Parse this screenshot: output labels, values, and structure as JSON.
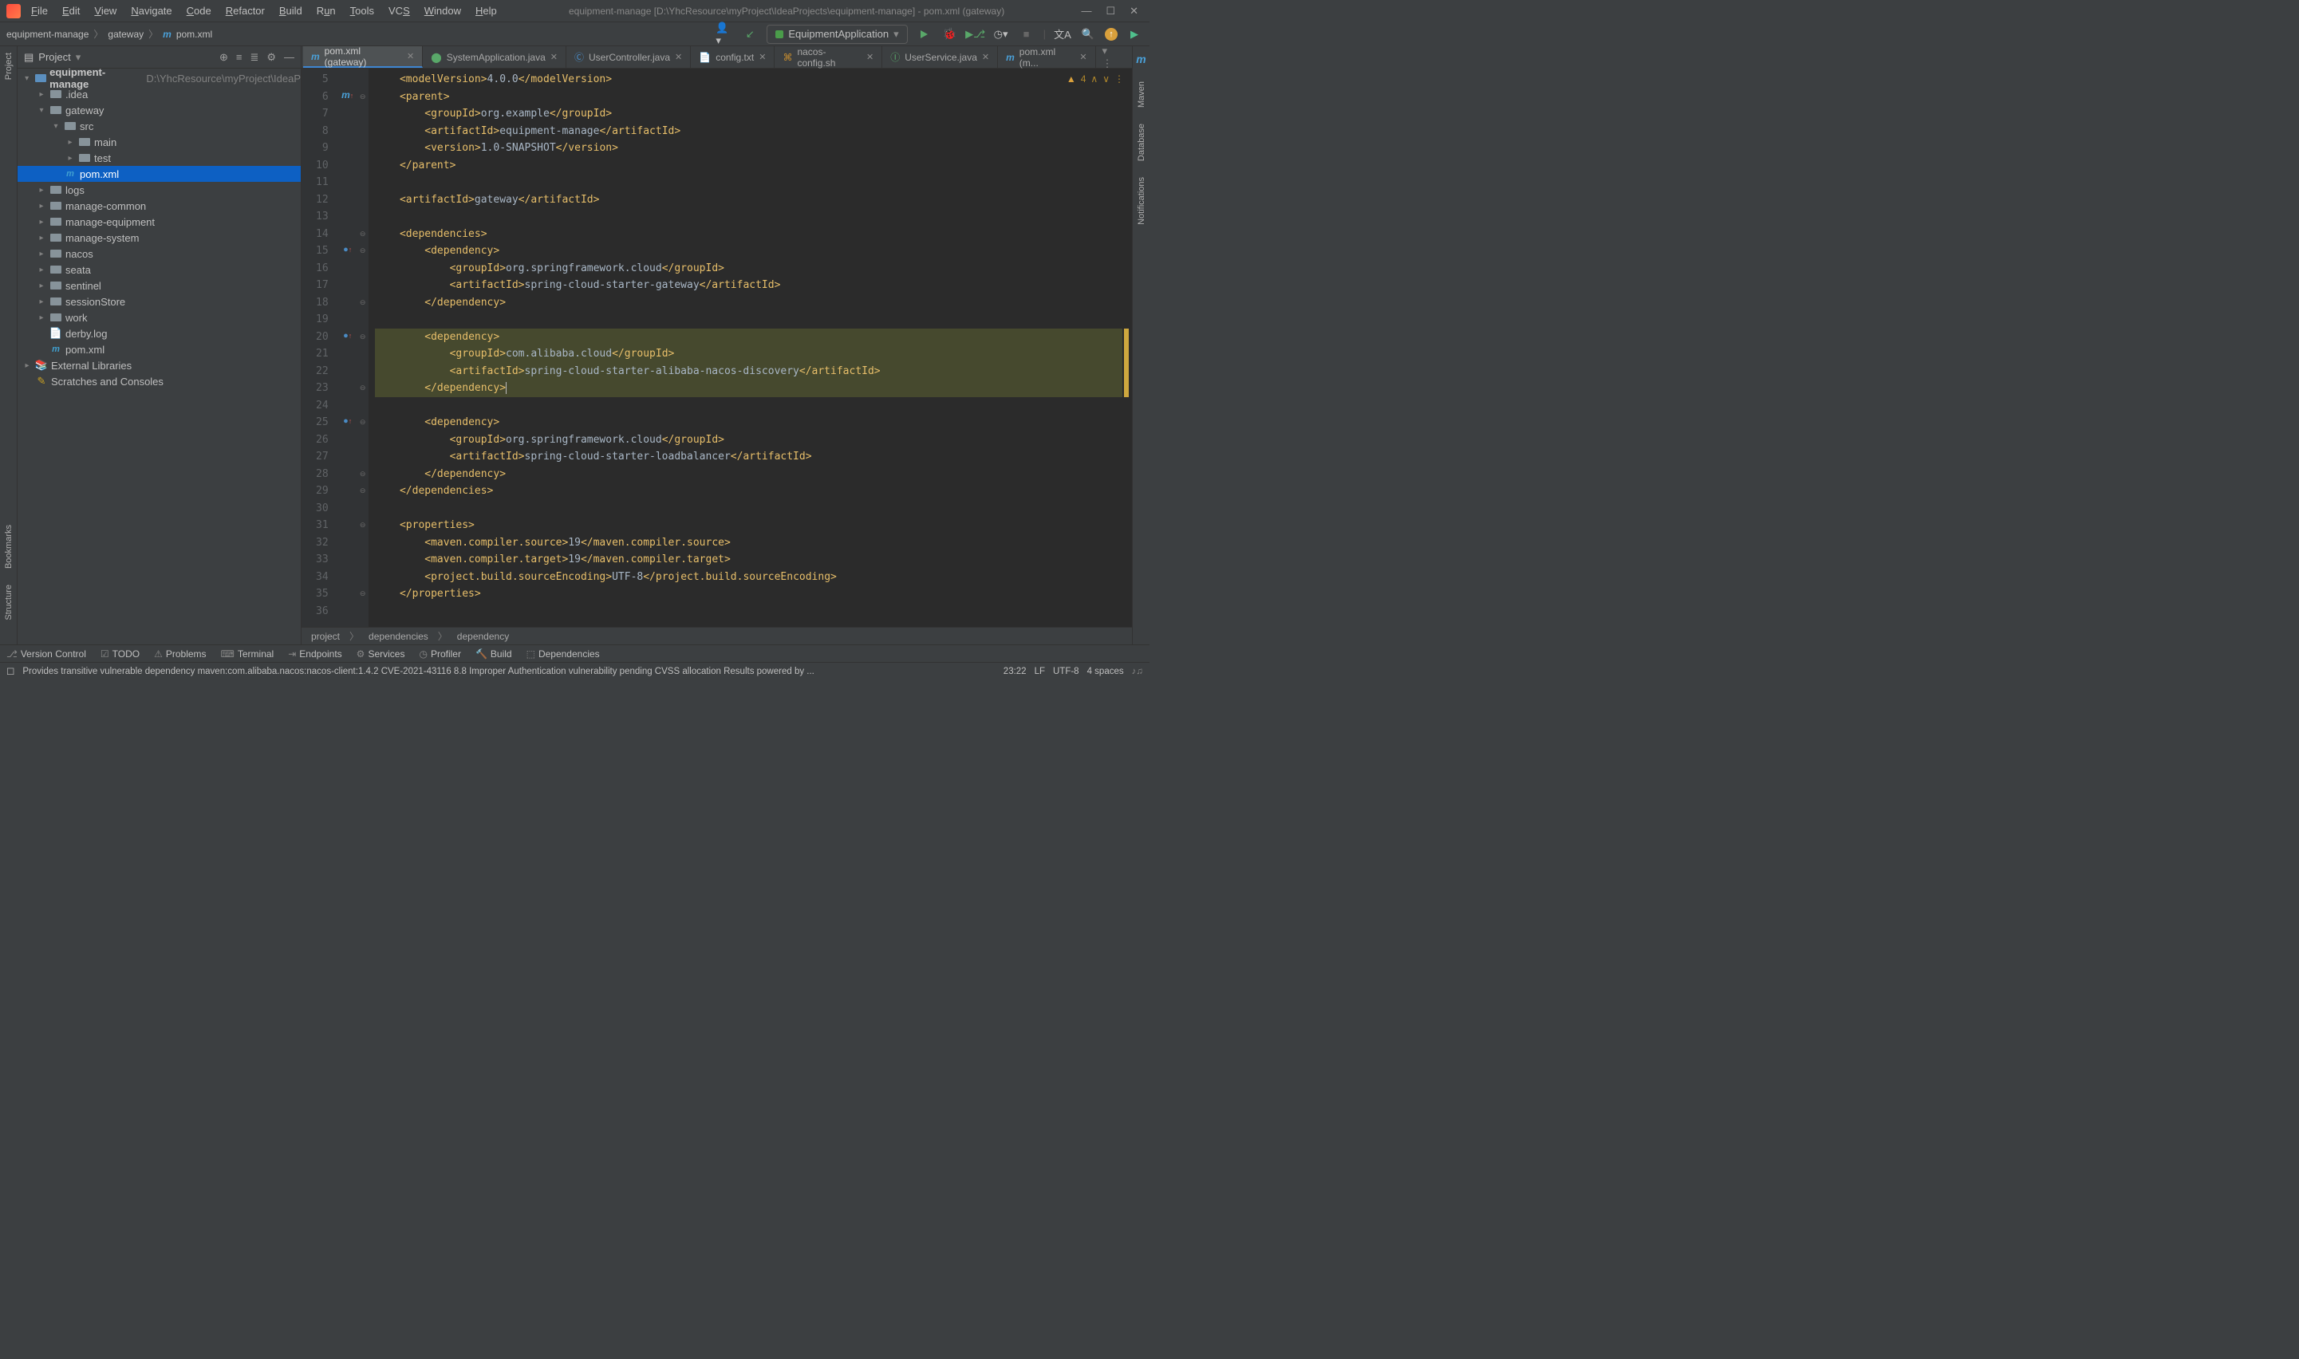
{
  "window_title": "equipment-manage [D:\\YhcResource\\myProject\\IdeaProjects\\equipment-manage] - pom.xml (gateway)",
  "menu": [
    "File",
    "Edit",
    "View",
    "Navigate",
    "Code",
    "Refactor",
    "Build",
    "Run",
    "Tools",
    "VCS",
    "Window",
    "Help"
  ],
  "menu_underline_idx": [
    0,
    0,
    0,
    0,
    0,
    0,
    0,
    1,
    0,
    2,
    0,
    0
  ],
  "breadcrumb": [
    "equipment-manage",
    "gateway",
    "pom.xml"
  ],
  "run_config": "EquipmentApplication",
  "project_label": "Project",
  "tree": {
    "root": "equipment-manage",
    "root_path": "D:\\YhcResource\\myProject\\IdeaP",
    "items": [
      {
        "label": ".idea",
        "depth": 1,
        "chev": "▸"
      },
      {
        "label": "gateway",
        "depth": 1,
        "chev": "▾"
      },
      {
        "label": "src",
        "depth": 2,
        "chev": "▾"
      },
      {
        "label": "main",
        "depth": 3,
        "chev": "▸"
      },
      {
        "label": "test",
        "depth": 3,
        "chev": "▸"
      },
      {
        "label": "pom.xml",
        "depth": 2,
        "chev": "",
        "icon": "m",
        "sel": true
      },
      {
        "label": "logs",
        "depth": 1,
        "chev": "▸"
      },
      {
        "label": "manage-common",
        "depth": 1,
        "chev": "▸"
      },
      {
        "label": "manage-equipment",
        "depth": 1,
        "chev": "▸"
      },
      {
        "label": "manage-system",
        "depth": 1,
        "chev": "▸"
      },
      {
        "label": "nacos",
        "depth": 1,
        "chev": "▸"
      },
      {
        "label": "seata",
        "depth": 1,
        "chev": "▸"
      },
      {
        "label": "sentinel",
        "depth": 1,
        "chev": "▸"
      },
      {
        "label": "sessionStore",
        "depth": 1,
        "chev": "▸"
      },
      {
        "label": "work",
        "depth": 1,
        "chev": "▸"
      },
      {
        "label": "derby.log",
        "depth": 1,
        "chev": "",
        "icon": "f"
      },
      {
        "label": "pom.xml",
        "depth": 1,
        "chev": "",
        "icon": "m"
      }
    ],
    "ext_lib": "External Libraries",
    "scratches": "Scratches and Consoles"
  },
  "tabs": [
    {
      "label": "pom.xml (gateway)",
      "active": true,
      "icon": "m"
    },
    {
      "label": "SystemApplication.java",
      "icon": "j"
    },
    {
      "label": "UserController.java",
      "icon": "c"
    },
    {
      "label": "config.txt",
      "icon": "t"
    },
    {
      "label": "nacos-config.sh",
      "icon": "sh"
    },
    {
      "label": "UserService.java",
      "icon": "i"
    },
    {
      "label": "pom.xml (m...",
      "icon": "m"
    }
  ],
  "line_start": 5,
  "line_end": 36,
  "code_lines": [
    {
      "n": 5,
      "ind": 1,
      "seg": [
        [
          "tag",
          "<modelVersion>"
        ],
        [
          "txt",
          "4.0.0"
        ],
        [
          "tag",
          "</modelVersion>"
        ]
      ]
    },
    {
      "n": 6,
      "ind": 1,
      "seg": [
        [
          "tag",
          "<parent>"
        ]
      ],
      "mark": "m↑"
    },
    {
      "n": 7,
      "ind": 2,
      "seg": [
        [
          "tag",
          "<groupId>"
        ],
        [
          "txt",
          "org.example"
        ],
        [
          "tag",
          "</groupId>"
        ]
      ]
    },
    {
      "n": 8,
      "ind": 2,
      "seg": [
        [
          "tag",
          "<artifactId>"
        ],
        [
          "txt",
          "equipment-manage"
        ],
        [
          "tag",
          "</artifactId>"
        ]
      ]
    },
    {
      "n": 9,
      "ind": 2,
      "seg": [
        [
          "tag",
          "<version>"
        ],
        [
          "txt",
          "1.0-SNAPSHOT"
        ],
        [
          "tag",
          "</version>"
        ]
      ]
    },
    {
      "n": 10,
      "ind": 1,
      "seg": [
        [
          "tag",
          "</parent>"
        ]
      ]
    },
    {
      "n": 11,
      "ind": 0,
      "seg": []
    },
    {
      "n": 12,
      "ind": 1,
      "seg": [
        [
          "tag",
          "<artifactId>"
        ],
        [
          "txt",
          "gateway"
        ],
        [
          "tag",
          "</artifactId>"
        ]
      ]
    },
    {
      "n": 13,
      "ind": 0,
      "seg": []
    },
    {
      "n": 14,
      "ind": 1,
      "seg": [
        [
          "tag",
          "<dependencies>"
        ]
      ]
    },
    {
      "n": 15,
      "ind": 2,
      "seg": [
        [
          "tag",
          "<dependency>"
        ]
      ],
      "mark": "o↑"
    },
    {
      "n": 16,
      "ind": 3,
      "seg": [
        [
          "tag",
          "<groupId>"
        ],
        [
          "txt",
          "org.springframework.cloud"
        ],
        [
          "tag",
          "</groupId>"
        ]
      ]
    },
    {
      "n": 17,
      "ind": 3,
      "seg": [
        [
          "tag",
          "<artifactId>"
        ],
        [
          "txt",
          "spring-cloud-starter-gateway"
        ],
        [
          "tag",
          "</artifactId>"
        ]
      ]
    },
    {
      "n": 18,
      "ind": 2,
      "seg": [
        [
          "tag",
          "</dependency>"
        ]
      ]
    },
    {
      "n": 19,
      "ind": 0,
      "seg": []
    },
    {
      "n": 20,
      "ind": 2,
      "seg": [
        [
          "tag",
          "<dependency>"
        ]
      ],
      "mark": "o↑",
      "hl": true
    },
    {
      "n": 21,
      "ind": 3,
      "seg": [
        [
          "tag",
          "<groupId>"
        ],
        [
          "txt",
          "com.alibaba.cloud"
        ],
        [
          "tag",
          "</groupId>"
        ]
      ],
      "hl": true
    },
    {
      "n": 22,
      "ind": 3,
      "seg": [
        [
          "tag",
          "<artifactId>"
        ],
        [
          "txt",
          "spring-cloud-starter-alibaba-nacos-discovery"
        ],
        [
          "tag",
          "</artifactId>"
        ]
      ],
      "hl": true
    },
    {
      "n": 23,
      "ind": 2,
      "seg": [
        [
          "tag",
          "</dependency>"
        ]
      ],
      "hl": true,
      "caret": true
    },
    {
      "n": 24,
      "ind": 0,
      "seg": []
    },
    {
      "n": 25,
      "ind": 2,
      "seg": [
        [
          "tag",
          "<dependency>"
        ]
      ],
      "mark": "o↑"
    },
    {
      "n": 26,
      "ind": 3,
      "seg": [
        [
          "tag",
          "<groupId>"
        ],
        [
          "txt",
          "org.springframework.cloud"
        ],
        [
          "tag",
          "</groupId>"
        ]
      ]
    },
    {
      "n": 27,
      "ind": 3,
      "seg": [
        [
          "tag",
          "<artifactId>"
        ],
        [
          "txt",
          "spring-cloud-starter-loadbalancer"
        ],
        [
          "tag",
          "</artifactId>"
        ]
      ]
    },
    {
      "n": 28,
      "ind": 2,
      "seg": [
        [
          "tag",
          "</dependency>"
        ]
      ]
    },
    {
      "n": 29,
      "ind": 1,
      "seg": [
        [
          "tag",
          "</dependencies>"
        ]
      ]
    },
    {
      "n": 30,
      "ind": 0,
      "seg": []
    },
    {
      "n": 31,
      "ind": 1,
      "seg": [
        [
          "tag",
          "<properties>"
        ]
      ]
    },
    {
      "n": 32,
      "ind": 2,
      "seg": [
        [
          "tag",
          "<maven.compiler.source>"
        ],
        [
          "txt",
          "19"
        ],
        [
          "tag",
          "</maven.compiler.source>"
        ]
      ]
    },
    {
      "n": 33,
      "ind": 2,
      "seg": [
        [
          "tag",
          "<maven.compiler.target>"
        ],
        [
          "txt",
          "19"
        ],
        [
          "tag",
          "</maven.compiler.target>"
        ]
      ]
    },
    {
      "n": 34,
      "ind": 2,
      "seg": [
        [
          "tag",
          "<project.build.sourceEncoding>"
        ],
        [
          "txt",
          "UTF-8"
        ],
        [
          "tag",
          "</project.build.sourceEncoding>"
        ]
      ]
    },
    {
      "n": 35,
      "ind": 1,
      "seg": [
        [
          "tag",
          "</properties>"
        ]
      ]
    },
    {
      "n": 36,
      "ind": 0,
      "seg": []
    }
  ],
  "inspection_count": "4",
  "editor_crumbs": [
    "project",
    "dependencies",
    "dependency"
  ],
  "left_tools": [
    "Project"
  ],
  "left_tools_bottom": [
    "Bookmarks",
    "Structure"
  ],
  "right_tools": [
    "Maven",
    "Database",
    "Notifications"
  ],
  "bottom_tools": [
    "Version Control",
    "TODO",
    "Problems",
    "Terminal",
    "Endpoints",
    "Services",
    "Profiler",
    "Build",
    "Dependencies"
  ],
  "status_msg": "Provides transitive vulnerable dependency maven:com.alibaba.nacos:nacos-client:1.4.2 CVE-2021-43116 8.8 Improper Authentication vulnerability pending CVSS allocation   Results powered by ...",
  "status_right": {
    "time": "23:22",
    "sep": "LF",
    "enc": "UTF-8",
    "indent": "4 spaces"
  }
}
